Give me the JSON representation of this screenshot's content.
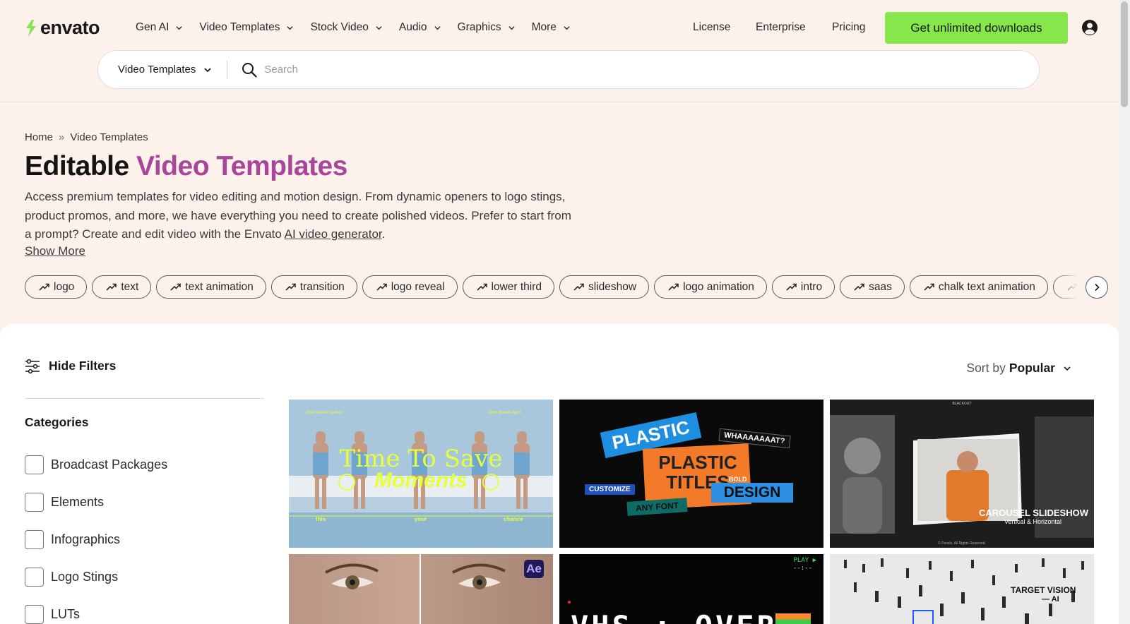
{
  "header": {
    "logo_text": "envato",
    "nav": [
      {
        "label": "Gen AI"
      },
      {
        "label": "Video Templates"
      },
      {
        "label": "Stock Video"
      },
      {
        "label": "Audio"
      },
      {
        "label": "Graphics"
      },
      {
        "label": "More"
      }
    ],
    "links": {
      "license": "License",
      "enterprise": "Enterprise",
      "pricing": "Pricing"
    },
    "cta_label": "Get unlimited downloads",
    "colors": {
      "cta": "#87e64b",
      "accent": "#a8479a",
      "background": "#fdf2eb",
      "logo_leaf": "#87e64b"
    }
  },
  "search": {
    "category": "Video Templates",
    "placeholder": "Search",
    "value": ""
  },
  "breadcrumb": {
    "home": "Home",
    "separator": "»",
    "current": "Video Templates"
  },
  "hero": {
    "title_plain": "Editable",
    "title_accent": "Video Templates",
    "description_1": "Access premium templates for video editing and motion design. From dynamic openers to logo stings, product promos, and more, we have everything you need to create polished videos. Prefer to start from a prompt? Create and edit video with the Envato",
    "description_link": "AI video generator",
    "description_end": ".",
    "show_more": "Show More"
  },
  "tags": [
    "logo",
    "text",
    "text animation",
    "transition",
    "logo reveal",
    "lower third",
    "slideshow",
    "logo animation",
    "intro",
    "saas",
    "chalk text animation",
    "logo"
  ],
  "filters": {
    "toggle_label": "Hide Filters",
    "categories_title": "Categories",
    "categories": [
      "Broadcast Packages",
      "Elements",
      "Infographics",
      "Logo Stings",
      "LUTs"
    ]
  },
  "sort": {
    "prefix": "Sort by",
    "value": "Popular"
  },
  "thumbnails": [
    {
      "line1": "Time To Save",
      "line2": "Moments",
      "top_left": "2024  David Carlson",
      "top_right": "John Wilson    April",
      "bottom": [
        "this",
        "your",
        "chance"
      ]
    },
    {
      "words": [
        "PLASTIC",
        "PLASTIC",
        "TITLES",
        "WHAAAAAAAT?",
        "BOLD",
        "DESIGN",
        "CUSTOMIZE",
        "ANY FONT"
      ]
    },
    {
      "brand": "BLACKOUT",
      "title": "CAROUSEL SLIDESHOW",
      "subtitle": "Vertical & Horizontal",
      "footer": "© Pexels. All Rights Reserved."
    },
    {
      "badge": "Ae"
    },
    {
      "play_label": "PLAY ▶",
      "counter": "--:--",
      "title": "VHS : OVER"
    },
    {
      "title": "TARGET VISION",
      "subtitle": "— AI"
    }
  ]
}
